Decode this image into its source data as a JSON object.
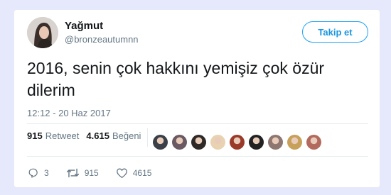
{
  "user": {
    "name": "Yağmut",
    "handle": "@bronzeautumnn"
  },
  "follow_button": {
    "label": "Takip et"
  },
  "tweet": {
    "text": "2016, senin çok hakkını yemişiz çok özür dilerim",
    "timestamp": "12:12 - 20 Haz 2017"
  },
  "stats": {
    "retweet_count": "915",
    "retweet_label": "Retweet",
    "like_count": "4.615",
    "like_label": "Beğeni"
  },
  "likers": [
    {
      "color": "#3b4048"
    },
    {
      "color": "#6b5a63"
    },
    {
      "color": "#2f2a28"
    },
    {
      "color": "#e8d2b2"
    },
    {
      "color": "#9a3b2a"
    },
    {
      "color": "#222222"
    },
    {
      "color": "#8d7770"
    },
    {
      "color": "#c7a05a"
    },
    {
      "color": "#b36a5e"
    }
  ],
  "actions": {
    "reply_count": "3",
    "retweet_count": "915",
    "like_count": "4615"
  },
  "colors": {
    "accent": "#1da1f2",
    "secondary_text": "#657786",
    "background": "#e6e8fb"
  }
}
